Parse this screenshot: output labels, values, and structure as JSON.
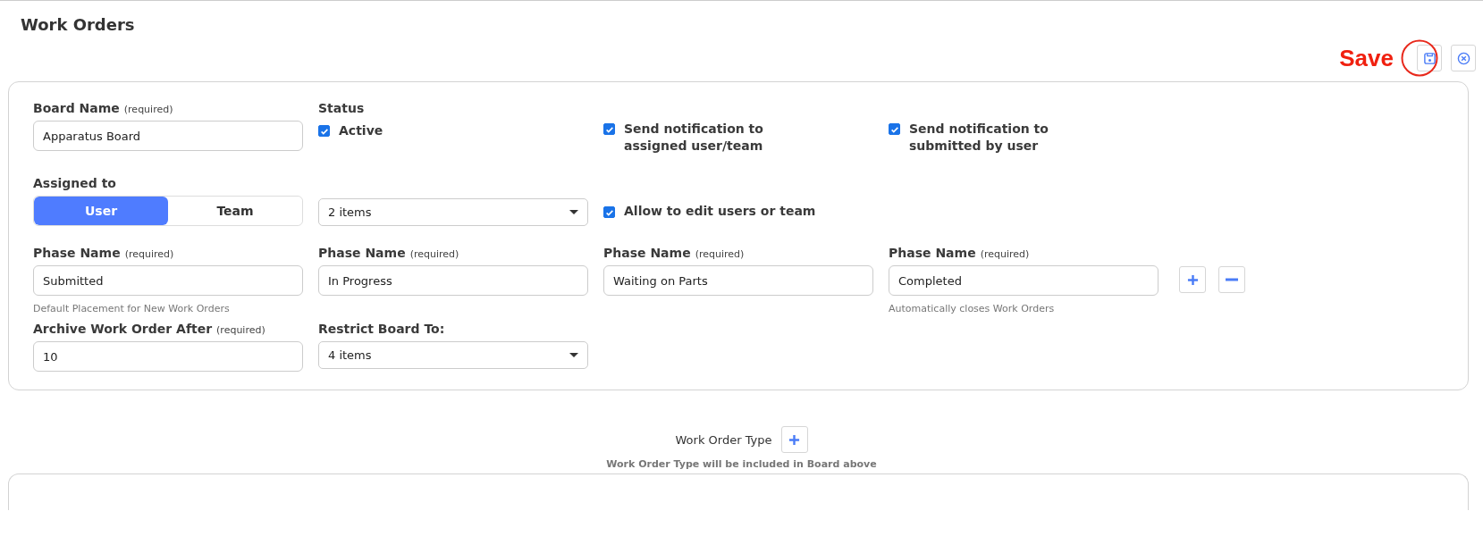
{
  "page_title": "Work Orders",
  "annotation": {
    "text": "Save"
  },
  "board_name": {
    "label": "Board Name",
    "required": "(required)",
    "value": "Apparatus Board"
  },
  "status": {
    "label": "Status"
  },
  "checkboxes": [
    {
      "label": "Active",
      "checked": true
    },
    {
      "label": "Send notification to assigned user/team",
      "checked": true
    },
    {
      "label": "Send notification to submitted by user",
      "checked": true
    }
  ],
  "assigned_to": {
    "label": "Assigned to",
    "options": [
      {
        "label": "User",
        "selected": true
      },
      {
        "label": "Team",
        "selected": false
      }
    ],
    "dropdown": "2 items",
    "allow_edit": {
      "label": "Allow to edit users or team",
      "checked": true
    }
  },
  "phases": [
    {
      "label": "Phase Name",
      "required": "(required)",
      "value": "Submitted",
      "hint": "Default Placement for New Work Orders"
    },
    {
      "label": "Phase Name",
      "required": "(required)",
      "value": "In Progress"
    },
    {
      "label": "Phase Name",
      "required": "(required)",
      "value": "Waiting on Parts"
    },
    {
      "label": "Phase Name",
      "required": "(required)",
      "value": "Completed",
      "hint": "Automatically closes Work Orders"
    }
  ],
  "archive": {
    "label": "Archive Work Order After",
    "required": "(required)",
    "value": "10"
  },
  "restrict": {
    "label": "Restrict Board To:",
    "dropdown": "4 items"
  },
  "work_order_type": {
    "label": "Work Order Type",
    "hint": "Work Order Type will be included in Board above"
  }
}
